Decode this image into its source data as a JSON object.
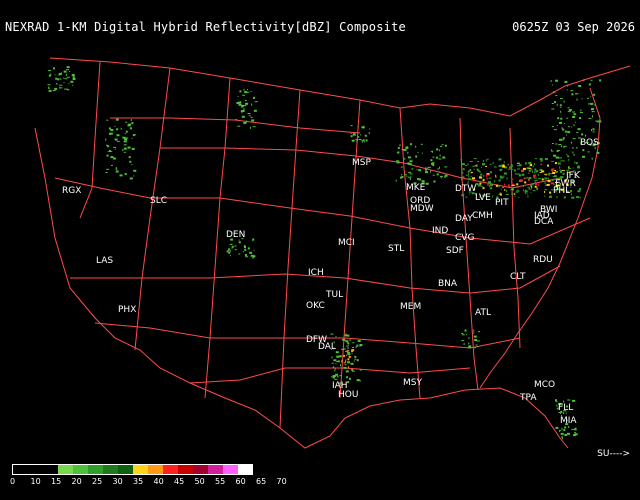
{
  "header": {
    "title": "NEXRAD 1-KM Digital Hybrid Reflectivity[dBZ] Composite",
    "timestamp": "0625Z 03 Sep 2026"
  },
  "colors": {
    "background": "#000000",
    "boundaries": "#ff4b4b",
    "text": "#ffffff"
  },
  "cities": [
    "RGX",
    "SLC",
    "DEN",
    "LAS",
    "PHX",
    "MSP",
    "MKE",
    "ORD",
    "MDW",
    "DTW",
    "LVE",
    "PIT",
    "BOS",
    "JFK",
    "EWR",
    "PHL",
    "BWI",
    "IAD",
    "DCA",
    "IND",
    "DAY",
    "CMH",
    "CVG",
    "SDF",
    "STL",
    "MCI",
    "ICH",
    "TUL",
    "OKC",
    "DFW",
    "DAL",
    "IAH",
    "HOU",
    "MEM",
    "BNA",
    "ATL",
    "CLT",
    "RDU",
    "MSY",
    "MCO",
    "TPA",
    "FLL",
    "MIA"
  ],
  "legend": {
    "labels": [
      "0",
      "10",
      "15",
      "20",
      "25",
      "30",
      "35",
      "40",
      "45",
      "50",
      "55",
      "60",
      "65",
      "70"
    ],
    "colors": [
      "#000000",
      "#000000",
      "#000000",
      "#7ad64a",
      "#4fc03a",
      "#2f9e2a",
      "#1f7a1d",
      "#106010",
      "#ffd21a",
      "#ff9a12",
      "#ff2020",
      "#c80000",
      "#a00030",
      "#d020a0",
      "#ff60ff",
      "#ffffff"
    ]
  },
  "motion_label": "SU---->"
}
